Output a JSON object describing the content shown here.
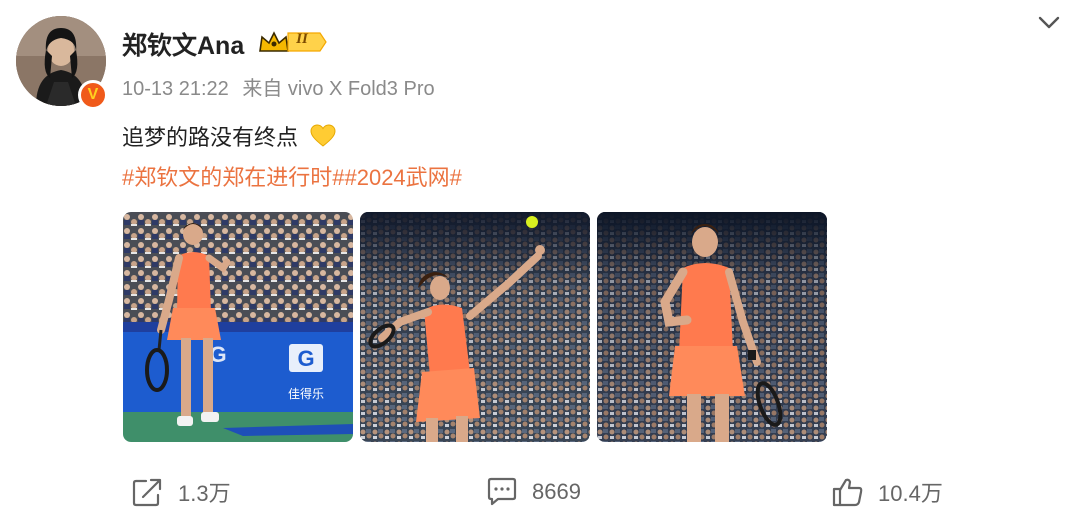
{
  "post": {
    "author": "郑钦文Ana",
    "vip_level": "II",
    "verified_mark": "V",
    "timestamp": "10-13 21:22",
    "source": "来自 vivo X Fold3 Pro",
    "text": "追梦的路没有终点",
    "emoji": "yellow-heart",
    "hashtags": [
      "#郑钦文的郑在进行时#",
      "#2024武网#"
    ],
    "photos": [
      {
        "board_text": "佳得乐"
      },
      {},
      {}
    ]
  },
  "actions": {
    "share_count": "1.3万",
    "comment_count": "8669",
    "like_count": "10.4万"
  },
  "colors": {
    "hashtag": "#eb7340",
    "meta": "#8a8a8a",
    "badge_orange": "#f05a1a",
    "vip_gold": "#f5b800"
  },
  "icons": [
    "chevron-down-icon",
    "share-icon",
    "comment-icon",
    "like-icon",
    "yellow-heart-icon",
    "vip-crown-icon",
    "verified-icon"
  ]
}
